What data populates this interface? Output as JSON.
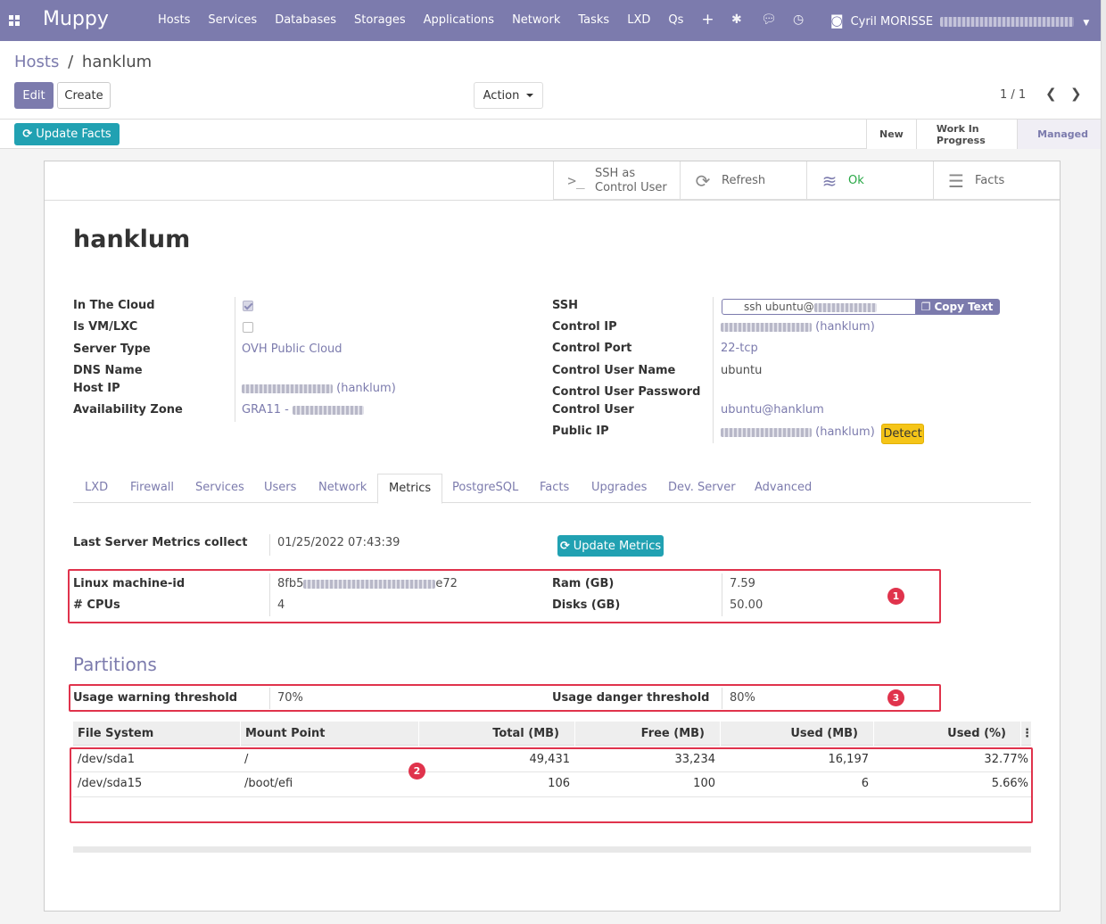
{
  "app": {
    "brand": "Muppy"
  },
  "nav": {
    "menus": [
      "Hosts",
      "Services",
      "Databases",
      "Storages",
      "Applications",
      "Network",
      "Tasks",
      "LXD",
      "Qs"
    ],
    "plus": "+",
    "user_name": "Cyril MORISSE",
    "user_suffix": "(...)"
  },
  "breadcrumb": {
    "parent": "Hosts",
    "sep": "/",
    "current": "hanklum"
  },
  "buttons": {
    "edit": "Edit",
    "create": "Create",
    "action": "Action",
    "update_facts": "Update Facts",
    "update_metrics": "Update Metrics",
    "copy_text": "Copy Text",
    "detect": "Detect"
  },
  "pager": {
    "value": "1 / 1"
  },
  "stages": [
    "New",
    "Work In Progress",
    "Managed"
  ],
  "smart_buttons": [
    {
      "icon": "terminal-icon",
      "label1": "SSH as",
      "label2": "Control User"
    },
    {
      "icon": "refresh-icon",
      "label1": "Refresh"
    },
    {
      "icon": "wifi-icon",
      "label1": "Ok"
    },
    {
      "icon": "list-icon",
      "label1": "Facts"
    }
  ],
  "record": {
    "title": "hanklum"
  },
  "left_fields": {
    "in_the_cloud": "In The Cloud",
    "is_vm": "Is VM/LXC",
    "server_type": "Server Type",
    "server_type_value": "OVH Public Cloud",
    "dns_name": "DNS Name",
    "host_ip": "Host IP",
    "host_ip_value": "(hanklum)",
    "availability_zone": "Availability Zone",
    "availability_zone_value": "GRA11 -"
  },
  "right_fields": {
    "ssh": "SSH",
    "ssh_value": "ssh ubuntu@",
    "control_ip": "Control IP",
    "control_ip_value": "(hanklum)",
    "control_port": "Control Port",
    "control_port_value": "22-tcp",
    "control_user_name": "Control User Name",
    "control_user_name_value": "ubuntu",
    "control_user_password": "Control User Password",
    "control_user": "Control User",
    "control_user_value": "ubuntu@hanklum",
    "public_ip": "Public IP",
    "public_ip_value": "(hanklum)"
  },
  "tabs": [
    "LXD",
    "Firewall",
    "Services",
    "Users",
    "Network",
    "Metrics",
    "PostgreSQL",
    "Facts",
    "Upgrades",
    "Dev. Server",
    "Advanced"
  ],
  "metrics": {
    "last_collect_label": "Last Server Metrics collect",
    "last_collect_value": "01/25/2022 07:43:39",
    "machine_id_label": "Linux machine-id",
    "machine_id_prefix": "8fb5",
    "machine_id_suffix": "e72",
    "cpus_label": "# CPUs",
    "cpus_value": "4",
    "ram_label": "Ram (GB)",
    "ram_value": "7.59",
    "disks_label": "Disks (GB)",
    "disks_value": "50.00"
  },
  "partitions": {
    "title": "Partitions",
    "warning_label": "Usage warning threshold",
    "warning_value": "70%",
    "danger_label": "Usage danger threshold",
    "danger_value": "80%",
    "columns": [
      "File System",
      "Mount Point",
      "Total (MB)",
      "Free (MB)",
      "Used (MB)",
      "Used (%)"
    ],
    "rows": [
      [
        "/dev/sda1",
        "/",
        "49,431",
        "33,234",
        "16,197",
        "32.77%"
      ],
      [
        "/dev/sda15",
        "/boot/efi",
        "106",
        "100",
        "6",
        "5.66%"
      ]
    ]
  },
  "annotations": [
    "1",
    "2",
    "3"
  ],
  "colors": {
    "primary": "#7c7bad",
    "teal": "#21a1b2",
    "annotation": "#e0334c",
    "detect": "#f5c518",
    "ok": "#28a745"
  }
}
